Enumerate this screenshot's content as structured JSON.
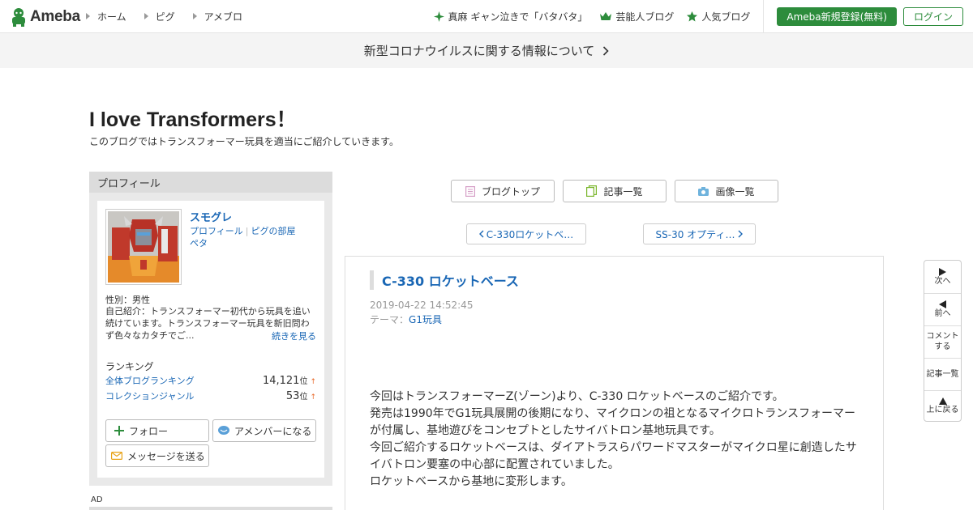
{
  "header": {
    "logo_text": "Ameba",
    "nav": [
      "ホーム",
      "ピグ",
      "アメブロ"
    ],
    "trending": "真麻 ギャン泣きで「バタバタ」",
    "celebrity_blog": "芸能人ブログ",
    "popular_blog": "人気ブログ",
    "register_label": "Ameba新規登録(無料)",
    "login_label": "ログイン",
    "accent_color": "#2d8c3c"
  },
  "notice": {
    "text": "新型コロナウイルスに関する情報について"
  },
  "blog": {
    "title": "I love Transformers！",
    "description": "このブログではトランスフォーマー玩具を適当にご紹介していきます。"
  },
  "sidebar": {
    "heading": "プロフィール",
    "username": "スモグレ",
    "link_profile": "プロフィール",
    "link_room": "ピグの部屋",
    "link_peta": "ペタ",
    "gender": "性別：男性",
    "bio": "自己紹介：トランスフォーマー初代から玩具を追い続けています。トランスフォーマー玩具を新旧問わず色々なカタチでご...",
    "read_more": "続きを見る",
    "ranking_heading": "ランキング",
    "rankings": [
      {
        "name": "全体ブログランキング",
        "value": "14,121",
        "unit": "位",
        "arrow": "↑"
      },
      {
        "name": "コレクションジャンル",
        "value": "53",
        "unit": "位",
        "arrow": "↑"
      }
    ],
    "follow_label": "フォロー",
    "amember_label": "アメンバーになる",
    "message_label": "メッセージを送る",
    "ad_label": "AD"
  },
  "main": {
    "blog_top": "ブログトップ",
    "article_list": "記事一覧",
    "image_list": "画像一覧",
    "prev_article": "C-330ロケットベ…",
    "next_article": "SS-30 オプティ…",
    "article": {
      "title": "C-330 ロケットベース",
      "date": "2019-04-22 14:52:45",
      "theme_label": "テーマ：",
      "theme": "G1玩具",
      "paragraphs": [
        "今回はトランスフォーマーZ(ゾーン)より、C-330 ロケットベースのご紹介です。",
        "発売は1990年でG1玩具展開の後期になり、マイクロンの祖となるマイクロトランスフォーマーが付属し、基地遊びをコンセプトとしたサイバトロン基地玩具です。",
        "今回ご紹介するロケットベースは、ダイアトラスらパワードマスターがマイクロ星に創造したサイバトロン要塞の中心部に配置されていました。",
        "ロケットベースから基地に変形します。"
      ]
    }
  },
  "floatnav": {
    "next": "次へ",
    "prev": "前へ",
    "comment_1": "コメント",
    "comment_2": "する",
    "list": "記事一覧",
    "top": "上に戻る"
  }
}
